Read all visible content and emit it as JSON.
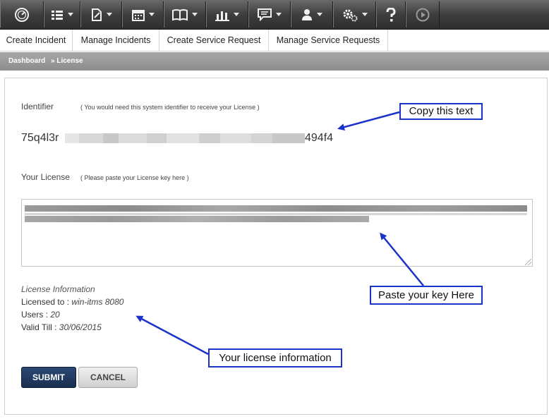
{
  "toolbar": {
    "items": [
      {
        "icon": "dashboard-icon",
        "has_caret": false
      },
      {
        "icon": "list-icon",
        "has_caret": true
      },
      {
        "icon": "edit-document-icon",
        "has_caret": true
      },
      {
        "icon": "calendar-icon",
        "has_caret": true
      },
      {
        "icon": "book-icon",
        "has_caret": true
      },
      {
        "icon": "bar-chart-icon",
        "has_caret": true
      },
      {
        "icon": "chat-icon",
        "has_caret": true
      },
      {
        "icon": "user-icon",
        "has_caret": true
      },
      {
        "icon": "settings-icon",
        "has_caret": true
      },
      {
        "icon": "help-icon",
        "has_caret": false
      },
      {
        "icon": "play-icon",
        "has_caret": false
      }
    ]
  },
  "subnav": {
    "tabs": [
      "Create Incident",
      "Manage Incidents",
      "Create Service Request",
      "Manage Service Requests"
    ]
  },
  "breadcrumb": {
    "root": "Dashboard",
    "current": "» License"
  },
  "form": {
    "identifier_label": "Identifier",
    "identifier_hint": "( You would need this system identifier to receive your License )",
    "identifier_prefix": "75q4l3r",
    "identifier_suffix": "494f4",
    "license_label": "Your License",
    "license_hint": "( Please paste your License key here )"
  },
  "license_info": {
    "heading": "License Information",
    "licensed_to_label": "Licensed to : ",
    "licensed_to_value": "win-itms 8080",
    "users_label": "Users : ",
    "users_value": "20",
    "valid_till_label": "Valid Till : ",
    "valid_till_value": "30/06/2015"
  },
  "buttons": {
    "submit": "SUBMIT",
    "cancel": "CANCEL"
  },
  "callouts": {
    "copy": "Copy this text",
    "paste": "Paste your key Here",
    "info": "Your license information"
  },
  "colors": {
    "callout_border": "#1a33c8",
    "submit_bg": "#1f3a60"
  }
}
